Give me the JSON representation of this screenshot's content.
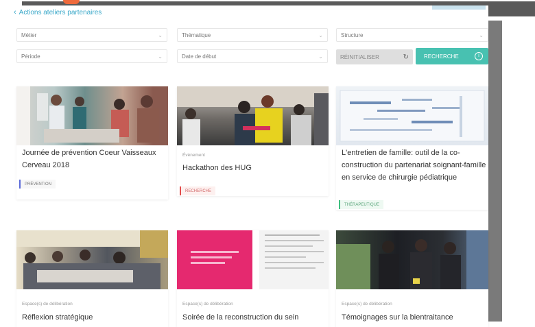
{
  "header": {
    "back_link": "Actions ateliers partenaires"
  },
  "filters": {
    "row1": [
      "Métier",
      "Thématique",
      "Structure"
    ],
    "row2": [
      "Période",
      "Date de début"
    ],
    "search_placeholder": "RÉINITIALISER",
    "submit_label": "RECHERCHE"
  },
  "cards": [
    {
      "category": "",
      "title": "Journée de prévention Coeur Vaisseaux Cerveau 2018",
      "tag": "PRÉVENTION",
      "tag_color": "#5a6ad8"
    },
    {
      "category": "Évènement",
      "title": "Hackathon des HUG",
      "tag": "RECHERCHE",
      "tag_color": "#e24b4b"
    },
    {
      "category": "",
      "title": "L'entretien de famille: outil de la co-construction du partenariat soignant-famille en service de chirurgie pédiatrique",
      "tag": "THÉRAPEUTIQUE",
      "tag_color": "#3fbf7f"
    },
    {
      "category": "Espace(s) de délibération",
      "title": "Réflexion stratégique",
      "tag": "",
      "tag_color": ""
    },
    {
      "category": "Espace(s) de délibération",
      "title": "Soirée de la reconstruction du sein",
      "tag": "",
      "tag_color": ""
    },
    {
      "category": "Espace(s) de délibération",
      "title": "Témoignages sur la bientraitance",
      "tag": "",
      "tag_color": ""
    }
  ],
  "icons": {
    "back": "chevron-left-icon",
    "caret": "chevron-down-icon",
    "refresh": "refresh-icon",
    "info": "info-icon"
  },
  "colors": {
    "accent": "#48c1b1",
    "link": "#3aa8c9"
  }
}
